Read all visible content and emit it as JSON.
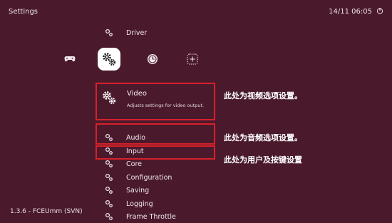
{
  "header": {
    "title": "Settings",
    "clock": "14/11 06:05"
  },
  "categories": [
    {
      "name": "gamepad",
      "icon": "gamepad-icon"
    },
    {
      "name": "settings",
      "icon": "gear-icon",
      "selected": true
    },
    {
      "name": "history",
      "icon": "history-icon"
    },
    {
      "name": "add",
      "icon": "plus-icon"
    }
  ],
  "menu": {
    "driver": "Driver",
    "video": {
      "title": "Video",
      "description": "Adjusts settings for video output."
    },
    "items": [
      "Audio",
      "Input",
      "Core",
      "Configuration",
      "Saving",
      "Logging",
      "Frame Throttle"
    ]
  },
  "annotations": {
    "video": "此处为视频选项设置。",
    "audio": "此处为音频选项设置。",
    "input": "此处为用户及按键设置"
  },
  "footer": {
    "version": "1.3.6 - FCEUmm (SVN)"
  },
  "colors": {
    "background": "#4a1a2c",
    "highlight_box": "#d8202a",
    "text": "#f1e6eb"
  }
}
